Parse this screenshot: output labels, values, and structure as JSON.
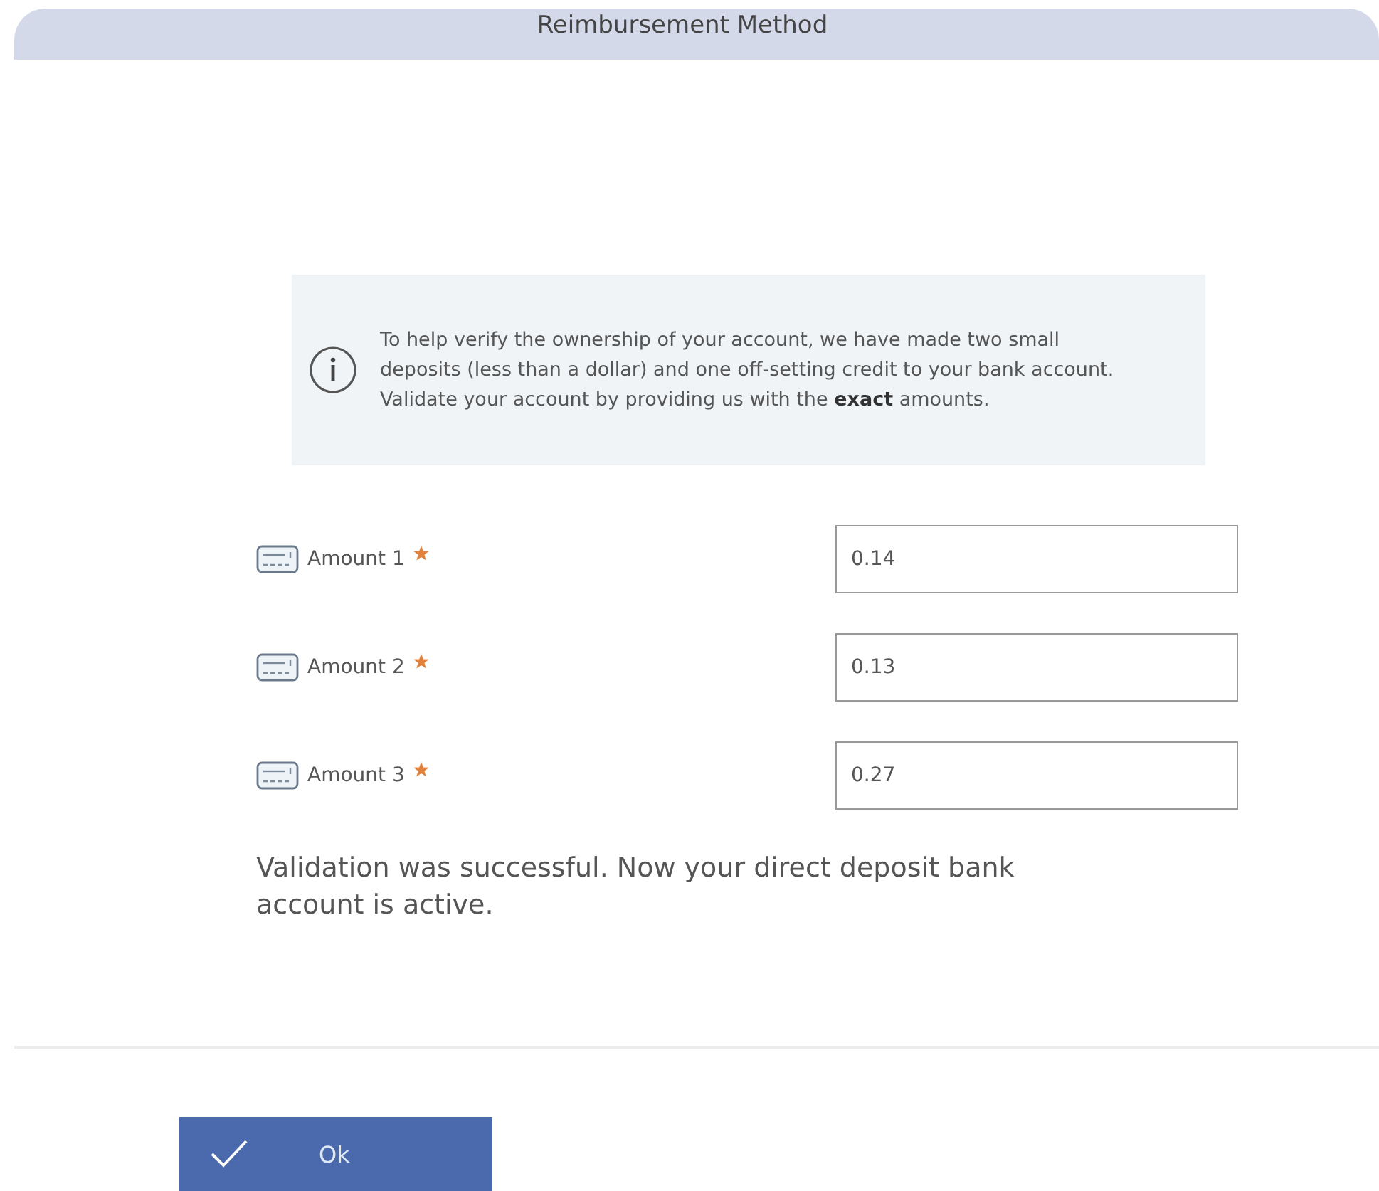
{
  "header": {
    "title": "Reimbursement Method"
  },
  "info": {
    "text": "To help verify the ownership of your account, we have made two small deposits (less than a dollar) and one off-setting credit to your bank account. Validate your account by providing us with the **exact** amounts."
  },
  "fields": [
    {
      "label": "Amount 1",
      "required": true,
      "value": "0.14"
    },
    {
      "label": "Amount 2",
      "required": true,
      "value": "0.13"
    },
    {
      "label": "Amount 3",
      "required": true,
      "value": "0.27"
    }
  ],
  "message": "Validation was successful. Now your direct deposit bank account is active.",
  "buttons": [
    {
      "label": "Ok"
    }
  ]
}
